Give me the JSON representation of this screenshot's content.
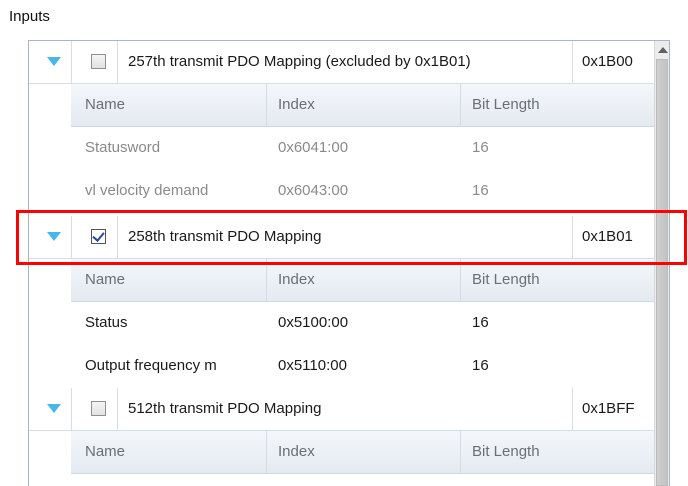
{
  "section": {
    "title": "Inputs"
  },
  "columns": {
    "name": "Name",
    "index": "Index",
    "bit_length": "Bit Length"
  },
  "mappings": [
    {
      "name": "257th transmit PDO Mapping (excluded by 0x1B01)",
      "index": "0x1B00",
      "checked": false,
      "entries": [
        {
          "name": "Statusword",
          "index": "0x6041:00",
          "bit_length": "16"
        },
        {
          "name": "vl velocity demand",
          "index": "0x6043:00",
          "bit_length": "16"
        }
      ]
    },
    {
      "name": "258th transmit PDO Mapping",
      "index": "0x1B01",
      "checked": true,
      "entries": [
        {
          "name": "Status",
          "index": "0x5100:00",
          "bit_length": "16"
        },
        {
          "name": "Output frequency m",
          "index": "0x5110:00",
          "bit_length": "16"
        }
      ]
    },
    {
      "name": "512th transmit PDO Mapping",
      "index": "0x1BFF",
      "checked": false,
      "entries": []
    }
  ],
  "colors": {
    "highlight": "#ff0000",
    "expander": "#45b7e8"
  },
  "icons": {
    "expander": "triangle-down-icon",
    "scroll_up": "arrow-up-icon"
  }
}
